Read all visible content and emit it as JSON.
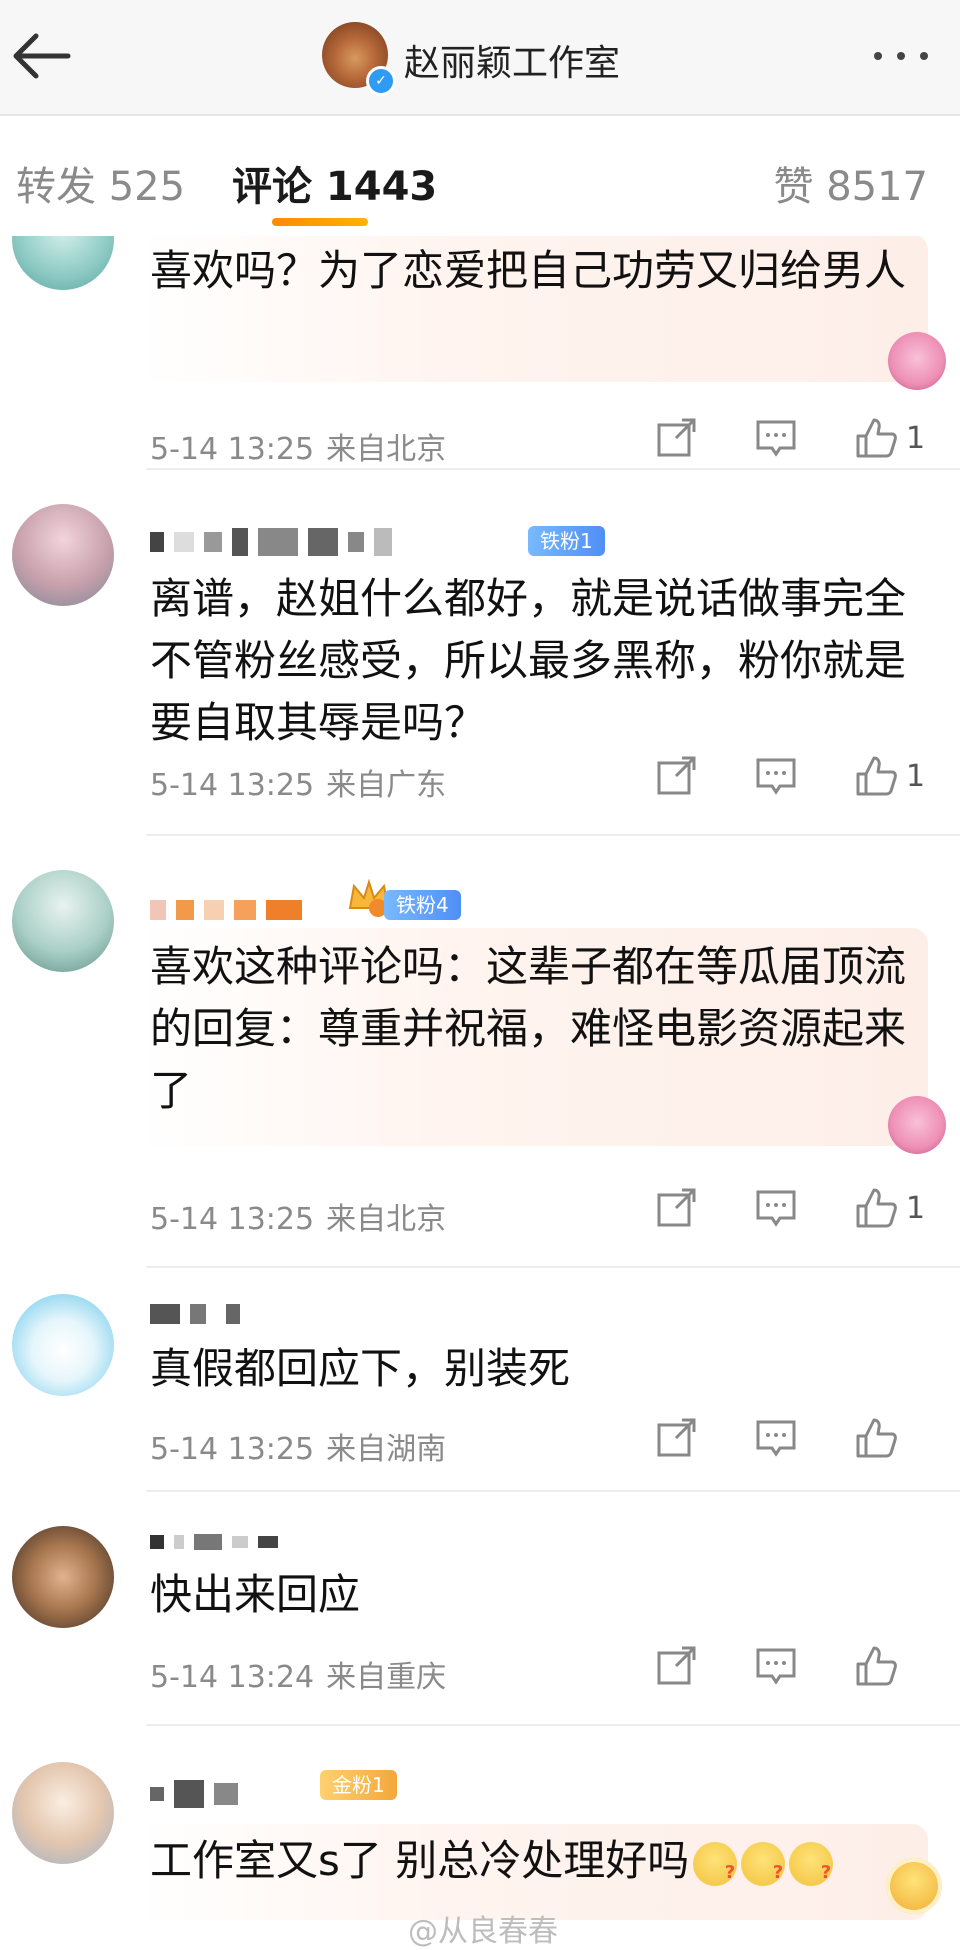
{
  "header": {
    "title": "赵丽颖工作室",
    "verified_mark": "✓"
  },
  "tabs": {
    "repost": "转发 525",
    "comments": "评论 1443",
    "likes": "赞 8517"
  },
  "comments": [
    {
      "text": "喜欢吗？为了恋爱把自己功劳又归给男人",
      "time": "5-14 13:25",
      "location": "来自北京",
      "likes": "1"
    },
    {
      "badge": "铁粉1",
      "text": "离谱，赵姐什么都好，就是说话做事完全不管粉丝感受，所以最多黑称，粉你就是要自取其辱是吗？",
      "time": "5-14 13:25",
      "location": "来自广东",
      "likes": "1"
    },
    {
      "badge": "铁粉4",
      "text": "喜欢这种评论吗：这辈子都在等瓜届顶流的回复：尊重并祝福，难怪电影资源起来了",
      "time": "5-14 13:25",
      "location": "来自北京",
      "likes": "1"
    },
    {
      "text": "真假都回应下，别装死",
      "time": "5-14 13:25",
      "location": "来自湖南",
      "likes": ""
    },
    {
      "text": "快出来回应",
      "time": "5-14 13:24",
      "location": "来自重庆",
      "likes": ""
    },
    {
      "badge": "金粉1",
      "text": "工作室又s了 别总冷处理好吗",
      "time": "",
      "location": "",
      "likes": ""
    }
  ],
  "watermark": "@从良春春"
}
